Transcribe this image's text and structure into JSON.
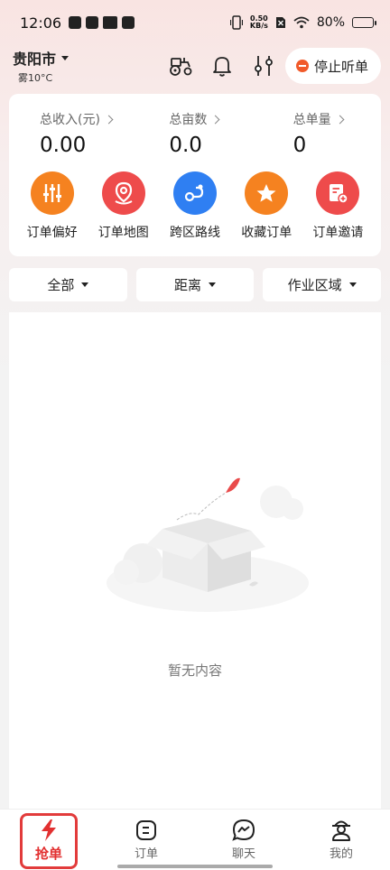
{
  "status_bar": {
    "time": "12:06",
    "net_speed_value": "0.50",
    "net_speed_unit": "KB/s",
    "battery": "80%",
    "battery_level": 0.8
  },
  "header": {
    "city": "贵阳市",
    "weather": "雾10°C",
    "stop_button_label": "停止听单"
  },
  "stats": [
    {
      "label": "总收入(元)",
      "value": "0.00"
    },
    {
      "label": "总亩数",
      "value": "0.0"
    },
    {
      "label": "总单量",
      "value": "0"
    }
  ],
  "quick_actions": [
    {
      "label": "订单偏好",
      "icon": "sliders-icon",
      "color": "#f58220"
    },
    {
      "label": "订单地图",
      "icon": "map-pin-icon",
      "color": "#ee4b4b"
    },
    {
      "label": "跨区路线",
      "icon": "route-icon",
      "color": "#2f7ff2"
    },
    {
      "label": "收藏订单",
      "icon": "star-icon",
      "color": "#f58220"
    },
    {
      "label": "订单邀请",
      "icon": "invite-icon",
      "color": "#ee4b4b"
    }
  ],
  "filters": [
    "全部",
    "距离",
    "作业区域"
  ],
  "empty_text": "暂无内容",
  "tabs": [
    {
      "label": "抢单",
      "icon": "lightning-icon",
      "active": true
    },
    {
      "label": "订单",
      "icon": "order-icon",
      "active": false
    },
    {
      "label": "聊天",
      "icon": "chat-icon",
      "active": false
    },
    {
      "label": "我的",
      "icon": "profile-icon",
      "active": false
    }
  ],
  "colors": {
    "accent_red": "#e23030",
    "accent_orange": "#f58220",
    "accent_blue": "#2f7ff2"
  }
}
